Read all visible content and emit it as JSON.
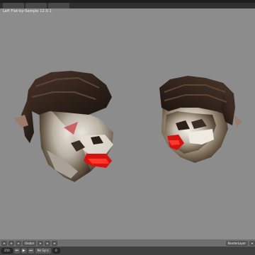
{
  "viewport": {
    "title": "Left Flat-by-Sample 12.0.1"
  },
  "view3d_header": {
    "global_label": "Global",
    "render_layer_label": "RenderLayer"
  },
  "timeline": {
    "frame": "250",
    "frame_end": "0",
    "sync_label": "No Sync",
    "play_icon": "play-icon",
    "rewind_icon": "rewind-icon",
    "forward_icon": "forward-icon"
  },
  "colors": {
    "viewport_bg": "#8c8c8c",
    "header_bg": "#6f6f6f",
    "timeline_bg": "#404040"
  }
}
